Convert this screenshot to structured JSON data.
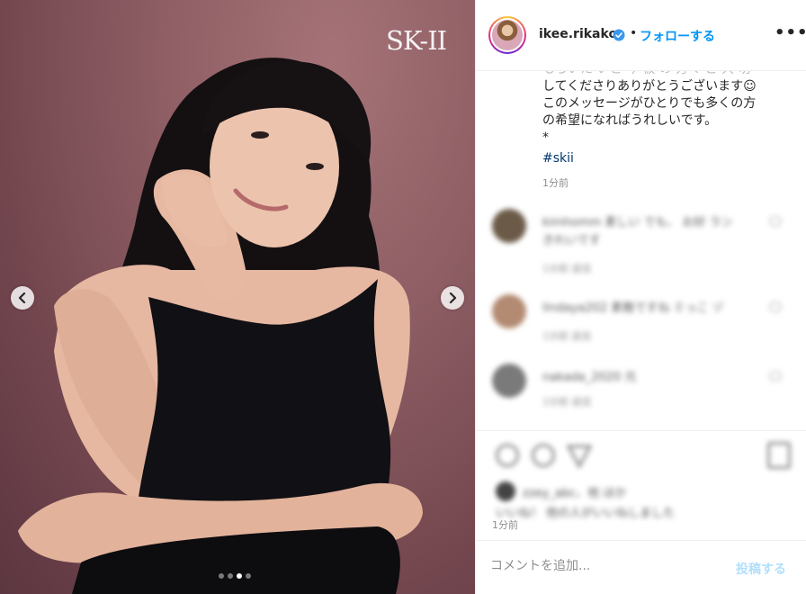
{
  "photo": {
    "brand_logo": "SK-II",
    "carousel": {
      "total": 4,
      "active_index": 2
    },
    "prev_icon": "chevron-left-icon",
    "next_icon": "chevron-right-icon"
  },
  "header": {
    "username": "ikee.rikako",
    "verified_icon": "verified-badge-icon",
    "separator": "•",
    "follow_label": "フォローする",
    "more_icon": "more-options-icon",
    "more_label": "•••"
  },
  "caption": {
    "cut_line": "もらいた いと 今 板 の 方々 ご 大 切",
    "lines": [
      "してくださりありがとうございます☺",
      "このメッセージがひとりでも多くの方",
      "の希望になればうれしいです。",
      "*"
    ],
    "hashtag": "#skii",
    "time": "1分前"
  },
  "comments": [
    {
      "text": "kimhomm 素しい でも、 お好 ラン",
      "text2": "きれいです",
      "meta": "1分前   返信",
      "avatar_color": "#6b5a48"
    },
    {
      "text": "lindaya202 素敵ですね ミっこ ゾ",
      "meta": "1分前   返信",
      "avatar_color": "#b38a72"
    },
    {
      "text": "nakada_2020 元",
      "meta": "1分前   返信",
      "avatar_color": "#7a7a7a"
    }
  ],
  "actions": {
    "likes_text": "zzey_abc、他 ほか",
    "likes_text2": "いいね！ 他の人がいいねしました",
    "time": "1分前"
  },
  "add_comment": {
    "placeholder": "コメントを追加...",
    "post_label": "投稿する"
  },
  "colors": {
    "accent": "#0095f6",
    "post_disabled": "#b2dffc",
    "hashtag": "#00376b"
  }
}
